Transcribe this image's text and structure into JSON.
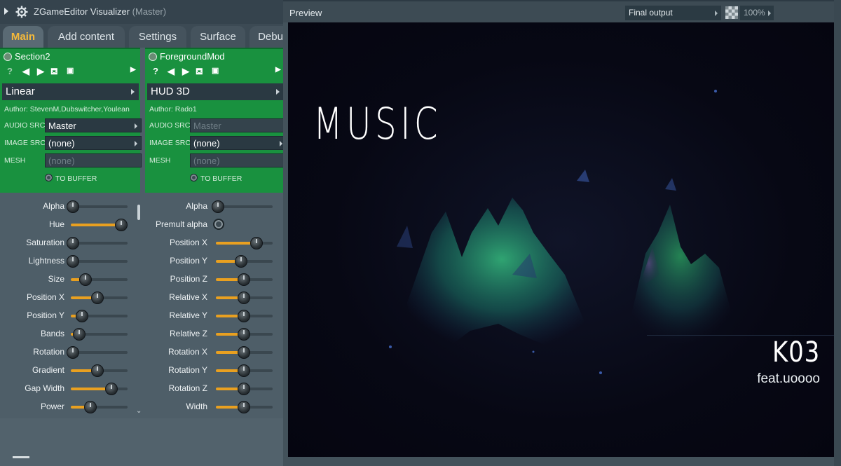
{
  "app": {
    "title": "ZGameEditor Visualizer",
    "title_suffix": "(Master)"
  },
  "tabs": [
    {
      "label": "Main",
      "active": true
    },
    {
      "label": "Add content",
      "active": false
    },
    {
      "label": "Settings",
      "active": false
    },
    {
      "label": "Surface",
      "active": false
    },
    {
      "label": "Debu",
      "active": false
    }
  ],
  "sections": [
    {
      "name": "Section2",
      "effect": "Linear",
      "author": "Author: StevenM,Dubswitcher,Youlean",
      "audio_src_label": "AUDIO SRC",
      "audio_src": "Master",
      "image_src_label": "IMAGE SRC",
      "image_src": "(none)",
      "mesh_label": "MESH",
      "mesh": "(none)",
      "to_buffer": "TO BUFFER",
      "help_icon": "?",
      "params": [
        {
          "label": "Alpha",
          "value": 0.0
        },
        {
          "label": "Hue",
          "value": 0.95
        },
        {
          "label": "Saturation",
          "value": 0.0
        },
        {
          "label": "Lightness",
          "value": 0.0
        },
        {
          "label": "Size",
          "value": 0.25
        },
        {
          "label": "Position X",
          "value": 0.48
        },
        {
          "label": "Position Y",
          "value": 0.18
        },
        {
          "label": "Bands",
          "value": 0.12
        },
        {
          "label": "Rotation",
          "value": 0.0
        },
        {
          "label": "Gradient",
          "value": 0.48
        },
        {
          "label": "Gap Width",
          "value": 0.76
        },
        {
          "label": "Power",
          "value": 0.34
        }
      ]
    },
    {
      "name": "ForegroundMod",
      "effect": "HUD 3D",
      "author": "Author: Rado1",
      "audio_src_label": "AUDIO SRC",
      "audio_src": "Master",
      "image_src_label": "IMAGE SRC",
      "image_src": "(none)",
      "mesh_label": "MESH",
      "mesh": "(none)",
      "to_buffer": "TO BUFFER",
      "help_icon": "?",
      "params": [
        {
          "label": "Alpha",
          "value": 0.0,
          "type": "slider"
        },
        {
          "label": "Premult alpha",
          "value": 0.0,
          "type": "toggle"
        },
        {
          "label": "Position X",
          "value": 0.75,
          "type": "slider"
        },
        {
          "label": "Position Y",
          "value": 0.45,
          "type": "slider"
        },
        {
          "label": "Position Z",
          "value": 0.5,
          "type": "slider"
        },
        {
          "label": "Relative X",
          "value": 0.5,
          "type": "slider"
        },
        {
          "label": "Relative Y",
          "value": 0.5,
          "type": "slider"
        },
        {
          "label": "Relative Z",
          "value": 0.5,
          "type": "slider"
        },
        {
          "label": "Rotation X",
          "value": 0.5,
          "type": "slider"
        },
        {
          "label": "Rotation Y",
          "value": 0.5,
          "type": "slider"
        },
        {
          "label": "Rotation Z",
          "value": 0.5,
          "type": "slider"
        },
        {
          "label": "Width",
          "value": 0.5,
          "type": "slider"
        }
      ]
    }
  ],
  "preview": {
    "title": "Preview",
    "output": "Final output",
    "zoom": "100%",
    "overlay_title": "MUSIC",
    "artist": "K03",
    "feat": "feat.uoooo"
  },
  "colors": {
    "accent": "#e9a020",
    "section_bg": "#19913f",
    "active_tab_text": "#f5b93a"
  }
}
